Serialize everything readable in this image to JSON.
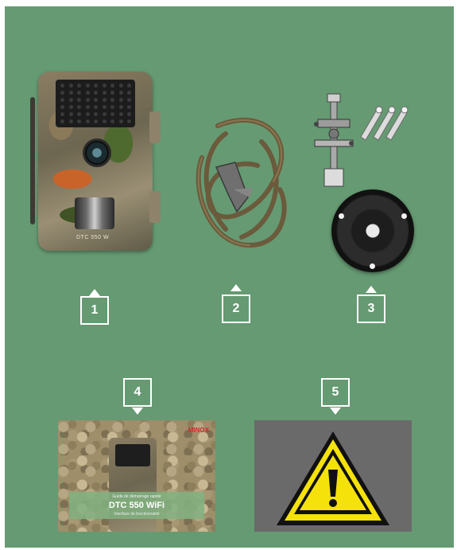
{
  "colors": {
    "panel": "#659a72",
    "marker": "#ffffff",
    "warning_yellow": "#f5e20a"
  },
  "items": [
    {
      "number": "1",
      "icon": "trail-camera-icon",
      "printed_text": "DTC 550 W"
    },
    {
      "number": "2",
      "icon": "strap-icon"
    },
    {
      "number": "3",
      "icon": "mount-bracket-icon"
    },
    {
      "number": "4",
      "icon": "manual-icon"
    },
    {
      "number": "5",
      "icon": "warning-icon"
    }
  ],
  "manual": {
    "brand": "MINOX",
    "small_line": "Guide de démarrage rapide",
    "title": "DTC 550 WiFi",
    "subtitle": "Interface de fonctionnalité"
  }
}
